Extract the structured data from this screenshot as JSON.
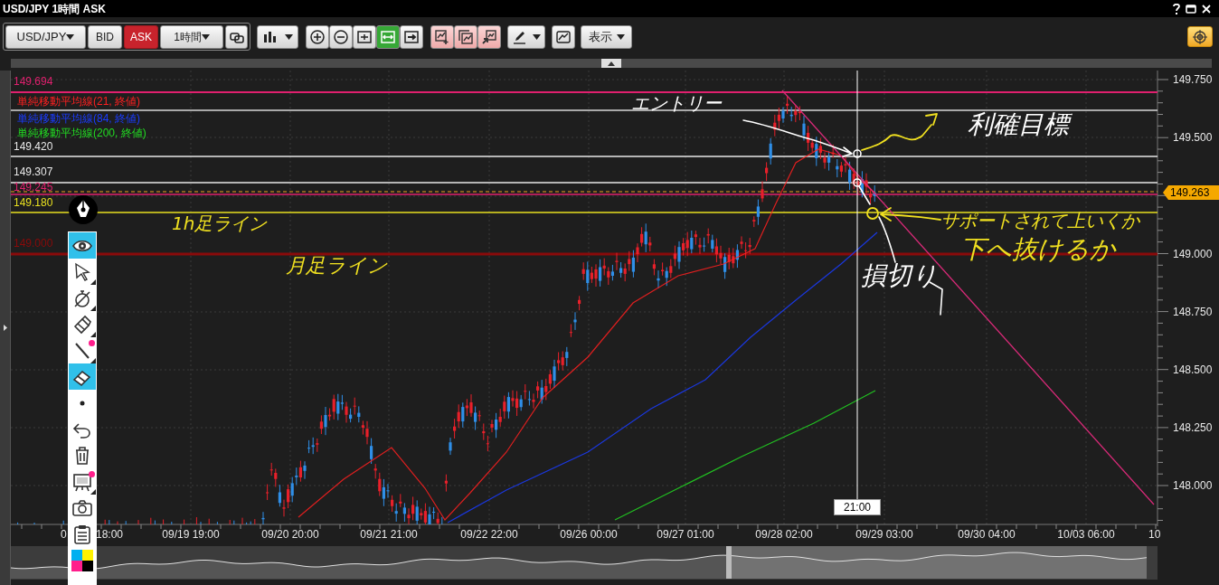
{
  "window": {
    "title": "USD/JPY 1時間 ASK"
  },
  "toolbar": {
    "symbol": "USD/JPY",
    "sides": [
      {
        "label": "BID",
        "selected": false
      },
      {
        "label": "ASK",
        "selected": true
      }
    ],
    "timeframe": "1時間",
    "view_tools": [
      {
        "kind": "zoom-in",
        "active": false
      },
      {
        "kind": "zoom-out",
        "active": false
      },
      {
        "kind": "fit",
        "active": false
      },
      {
        "kind": "stretch",
        "active": true
      },
      {
        "kind": "scroll-end",
        "active": false
      }
    ],
    "display_menu": "表示"
  },
  "chart": {
    "indicators": [
      {
        "label": "単純移動平均線(21, 終値)",
        "color": "#ff2020"
      },
      {
        "label": "単純移動平均線(84, 終値)",
        "color": "#1a3cff"
      },
      {
        "label": "単純移動平均線(200, 終値)",
        "color": "#22dd22"
      }
    ],
    "price_levels": [
      {
        "label": "149.694",
        "color": "#e0206e"
      },
      {
        "label": "149.420",
        "color": "#e8e8e8"
      },
      {
        "label": "149.307",
        "color": "#e8e8e8"
      },
      {
        "label": "149.245",
        "color": "#e0206e"
      },
      {
        "label": "149.180",
        "color": "#e8e020"
      },
      {
        "label": "149.000",
        "color": "#8a0a0a"
      }
    ],
    "y_axis": [
      "149.750",
      "149.500",
      "149.000",
      "148.750",
      "148.500",
      "148.250",
      "148.000"
    ],
    "current_price": "149.263",
    "crosshair_time": "21:00",
    "x_axis": [
      "0",
      "18:00",
      "09/19 19:00",
      "09/20 20:00",
      "09/21 21:00",
      "09/22 22:00",
      "09/26 00:00",
      "09/27 01:00",
      "09/28 02:00",
      "09/29 03:00",
      "09/30 04:00",
      "10/03 06:00",
      "10"
    ],
    "annotations": [
      {
        "text": "エントリー",
        "color": "#ffffff"
      },
      {
        "text": "利確目標",
        "color": "#ffffff"
      },
      {
        "text": "サポートされて上いくか",
        "color": "#f0e020"
      },
      {
        "text": "下へ抜けるか",
        "color": "#f0e020"
      },
      {
        "text": "損切り",
        "color": "#ffffff"
      },
      {
        "text": "1h足ライン",
        "color": "#f0e020"
      },
      {
        "text": "月足ライン",
        "color": "#f0e020"
      }
    ]
  },
  "drawing_tools": [
    {
      "kind": "eye",
      "selected": true,
      "marked": false,
      "submenu": false
    },
    {
      "kind": "pointer",
      "selected": false,
      "marked": false,
      "submenu": true
    },
    {
      "kind": "stopwatch",
      "selected": false,
      "marked": false,
      "submenu": true
    },
    {
      "kind": "pencil",
      "selected": false,
      "marked": false,
      "submenu": true
    },
    {
      "kind": "line",
      "selected": false,
      "marked": true,
      "submenu": true
    },
    {
      "kind": "eraser",
      "selected": true,
      "marked": false,
      "submenu": false
    },
    {
      "kind": "dot",
      "selected": false,
      "marked": false,
      "submenu": false
    },
    {
      "kind": "undo",
      "selected": false,
      "marked": false,
      "submenu": false
    },
    {
      "kind": "trash",
      "selected": false,
      "marked": false,
      "submenu": false
    },
    {
      "kind": "easel",
      "selected": false,
      "marked": true,
      "submenu": true
    },
    {
      "kind": "camera",
      "selected": false,
      "marked": false,
      "submenu": false
    },
    {
      "kind": "clipboard",
      "selected": false,
      "marked": false,
      "submenu": false
    },
    {
      "kind": "palette",
      "selected": false,
      "marked": false,
      "submenu": false
    }
  ]
}
